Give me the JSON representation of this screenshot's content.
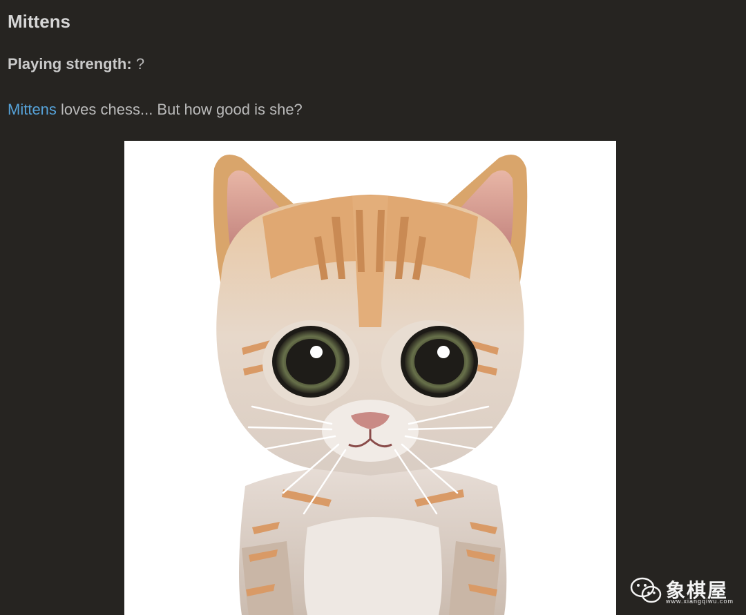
{
  "profile": {
    "name": "Mittens",
    "strength_label": "Playing strength:",
    "strength_value": "?",
    "desc_link": "Mittens",
    "desc_text": " loves chess... But how good is she?"
  },
  "avatar": {
    "icon": "kitten-icon",
    "bg_color": "#ffffff"
  },
  "watermark": {
    "icon": "wechat-icon",
    "text": "象棋屋",
    "url": "www.xiangqiwu.com"
  },
  "colors": {
    "background": "#262421",
    "link": "#56a2d8",
    "text": "#bababa"
  }
}
